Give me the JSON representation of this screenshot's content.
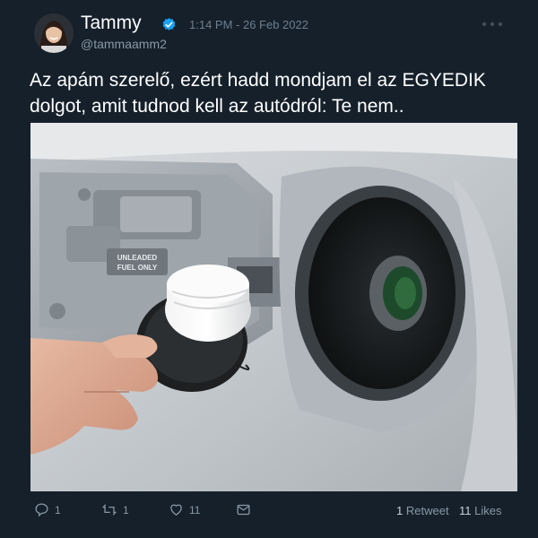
{
  "author": {
    "name": "Tammy",
    "handle": "@tammaamm2",
    "verified": true,
    "avatar": "woman-portrait"
  },
  "tweet": {
    "timestamp": "1:14 PM - 26 Feb 2022",
    "line1": "Az apám szerelő, ezért hadd mondjam el az EGYEDIK",
    "line2": "dolgot, amit tudnod kell az autódról: Te nem..",
    "media": {
      "label_line1": "UNLEADED",
      "label_line2": "FUEL ONLY"
    }
  },
  "actions": {
    "reply_count": "1",
    "retweet_count": "1",
    "like_count": "11"
  },
  "stats": {
    "retweets_value": "1",
    "retweets_label": "Retweet",
    "likes_value": "11",
    "likes_label": "Likes"
  },
  "colors": {
    "background": "#15202b",
    "verified": "#1da1f2",
    "muted": "#8899a6"
  }
}
